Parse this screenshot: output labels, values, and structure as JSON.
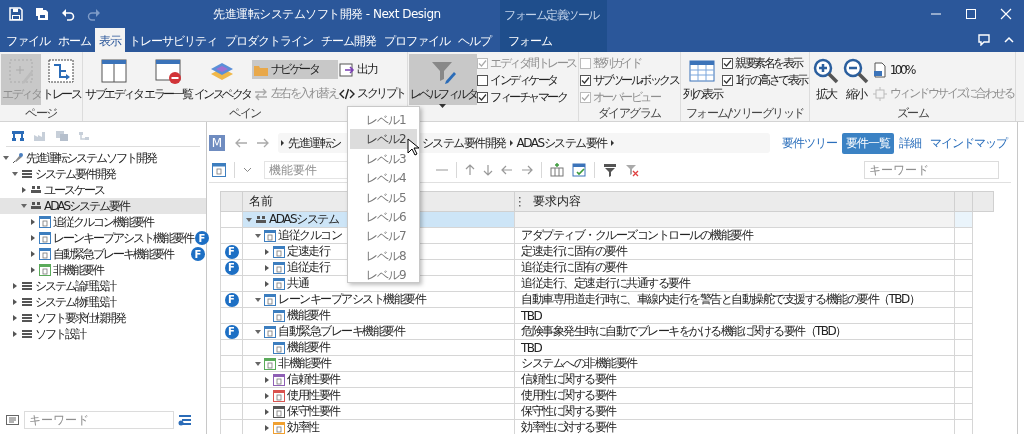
{
  "window": {
    "title": "先進運転システムソフト開発 - Next Design",
    "context_label": "フォーム定義ツール"
  },
  "tabs": [
    {
      "label": "ファイル",
      "kind": "main",
      "selected": false
    },
    {
      "label": "ホーム",
      "kind": "main",
      "selected": false
    },
    {
      "label": "表示",
      "kind": "main",
      "selected": true
    },
    {
      "label": "トレーサビリティ",
      "kind": "main",
      "selected": false
    },
    {
      "label": "プロダクトライン",
      "kind": "main",
      "selected": false
    },
    {
      "label": "チーム開発",
      "kind": "main",
      "selected": false
    },
    {
      "label": "プロファイル",
      "kind": "main",
      "selected": false
    },
    {
      "label": "ヘルプ",
      "kind": "main",
      "selected": false
    },
    {
      "label": "フォーム",
      "kind": "context",
      "selected": false
    }
  ],
  "ribbon": [
    {
      "label": "ページ",
      "columns": [
        [
          {
            "kind": "large",
            "label": "エディタ",
            "pressed": true,
            "disabled": true
          }
        ],
        [
          {
            "kind": "large",
            "label": "トレース",
            "pressed": false,
            "disabled": false
          }
        ]
      ]
    },
    {
      "label": "ペイン",
      "columns": [
        [
          {
            "kind": "large",
            "label": "サブエディタ",
            "pressed": false,
            "disabled": false
          }
        ],
        [
          {
            "kind": "large",
            "label": "エラー一覧",
            "pressed": false,
            "disabled": false
          }
        ],
        [
          {
            "kind": "large",
            "label": "インスペクタ",
            "pressed": false,
            "disabled": false
          }
        ],
        [
          {
            "kind": "small",
            "label": "ナビゲータ",
            "pressed": true,
            "disabled": false
          },
          {
            "kind": "small",
            "label": "左右を入れ替え",
            "pressed": false,
            "disabled": true
          }
        ],
        [
          {
            "kind": "small",
            "label": "出力",
            "pressed": false,
            "disabled": false
          },
          {
            "kind": "small",
            "label": "スクリプト",
            "pressed": false,
            "disabled": false
          }
        ]
      ]
    },
    {
      "columns": [
        [
          {
            "kind": "large",
            "label": "レベルフィルタ",
            "pressed": true,
            "disabled": false,
            "menu": true
          }
        ],
        [
          {
            "kind": "check",
            "label": "エディタ間トレース",
            "checked": true,
            "disabled": true
          },
          {
            "kind": "check",
            "label": "インディケータ",
            "checked": false,
            "disabled": false
          },
          {
            "kind": "check",
            "label": "フィーチャマーク",
            "checked": true,
            "disabled": false
          }
        ]
      ]
    },
    {
      "label": "ダイアグラム",
      "columns": [
        [
          {
            "kind": "check",
            "label": "整列ガイド",
            "checked": false,
            "disabled": true
          },
          {
            "kind": "check",
            "label": "サブツールボックス",
            "checked": true,
            "disabled": false
          },
          {
            "kind": "check",
            "label": "オーバービュー",
            "checked": true,
            "disabled": true
          }
        ]
      ]
    },
    {
      "label": "フォーム/ツリーグリッド",
      "columns": [
        [
          {
            "kind": "large",
            "label": "列の表示",
            "pressed": false,
            "disabled": false
          }
        ],
        [
          {
            "kind": "check",
            "label": "親要素名を表示",
            "checked": true,
            "disabled": false
          },
          {
            "kind": "check",
            "label": "1行の高さで表示",
            "checked": true,
            "disabled": false
          }
        ]
      ]
    },
    {
      "label": "ズーム",
      "columns": [
        [
          {
            "kind": "large",
            "label": "拡大",
            "pressed": false,
            "disabled": false
          }
        ],
        [
          {
            "kind": "large",
            "label": "縮小",
            "pressed": false,
            "disabled": false
          }
        ],
        [
          {
            "kind": "small",
            "label": "100%",
            "pressed": false,
            "disabled": false
          },
          {
            "kind": "small",
            "label": "ウィンドウサイズに合わせる",
            "pressed": false,
            "disabled": true
          }
        ]
      ]
    }
  ],
  "left_panel": {
    "tree": [
      {
        "label": "先進運転システムソフト開発",
        "kind": "project",
        "expanded": true,
        "selected": false,
        "children": [
          {
            "label": "システム要件開発",
            "kind": "list",
            "expanded": true,
            "selected": false,
            "children": [
              {
                "label": "ユースケース",
                "kind": "group",
                "expanded": false,
                "selected": false
              },
              {
                "label": "ADASシステム要件",
                "kind": "group",
                "expanded": true,
                "selected": true,
                "children": [
                  {
                    "label": "追従クルコン機能要件",
                    "kind": "requirement",
                    "color": "#3d7ebf",
                    "expanded": false,
                    "selected": false
                  },
                  {
                    "label": "レーンキープアシスト機能要件",
                    "kind": "requirement",
                    "color": "#3d7ebf",
                    "expanded": false,
                    "selected": false,
                    "badge": "F"
                  },
                  {
                    "label": "自動緊急ブレーキ機能要件",
                    "kind": "requirement",
                    "color": "#3d7ebf",
                    "expanded": false,
                    "selected": false,
                    "badge": "F"
                  },
                  {
                    "label": "非機能要件",
                    "kind": "requirement",
                    "color": "#5aaa5a",
                    "expanded": false,
                    "selected": false
                  }
                ]
              }
            ]
          },
          {
            "label": "システム論理設計",
            "kind": "list",
            "expanded": false,
            "selected": false
          },
          {
            "label": "システム物理設計",
            "kind": "list",
            "expanded": false,
            "selected": false
          },
          {
            "label": "ソフト要求仕様開発",
            "kind": "list",
            "expanded": false,
            "selected": false
          },
          {
            "label": "ソフト設計",
            "kind": "list",
            "expanded": false,
            "selected": false
          }
        ]
      }
    ],
    "search": {
      "placeholder": "キーワード"
    }
  },
  "editor": {
    "badge": "M",
    "breadcrumb": [
      "先進運転シ",
      "システム要件開発",
      "ADASシステム要件"
    ],
    "views": [
      {
        "label": "要件ツリー",
        "selected": false
      },
      {
        "label": "要件一覧",
        "selected": true
      },
      {
        "label": "詳細",
        "selected": false
      },
      {
        "label": "マインドマップ",
        "selected": false
      }
    ],
    "type_field": {
      "placeholder": "機能要件"
    },
    "keyword_field": {
      "placeholder": "キーワード"
    },
    "table": {
      "columns": [
        "名前",
        "要求内容"
      ],
      "rows": [
        {
          "name": "ADASシステム",
          "kind": "group",
          "expanded": true,
          "selected": true,
          "children": [
            {
              "name": "追従クルコン",
              "kind": "requirement",
              "color": "#3d7ebf",
              "expanded": true,
              "selected": false,
              "content": "アダプティブ・クルーズコントロールの機能要件",
              "children": [
                {
                  "name": "定速走行",
                  "kind": "requirement",
                  "color": "#3d7ebf",
                  "expanded": false,
                  "selected": false,
                  "badge": "F",
                  "content": "定速走行に固有の要件"
                },
                {
                  "name": "追従走行",
                  "kind": "requirement",
                  "color": "#3d7ebf",
                  "expanded": false,
                  "selected": false,
                  "badge": "F",
                  "content": "追従走行に固有の要件"
                },
                {
                  "name": "共通",
                  "kind": "requirement",
                  "color": "#3d7ebf",
                  "expanded": false,
                  "selected": false,
                  "content": "追従走行、定速走行に共通する要件"
                }
              ]
            },
            {
              "name": "レーンキープアシスト機能要件",
              "kind": "requirement",
              "color": "#3d7ebf",
              "expanded": true,
              "selected": false,
              "badge": "F",
              "content": "自動車専用道走行時に、車線内走行を警告と自動操舵で支援する機能の要件（TBD）",
              "children": [
                {
                  "name": "機能要件",
                  "kind": "requirement",
                  "color": "#3d7ebf",
                  "selected": false,
                  "content": "TBD"
                }
              ]
            },
            {
              "name": "自動緊急ブレーキ機能要件",
              "kind": "requirement",
              "color": "#3d7ebf",
              "expanded": true,
              "selected": false,
              "badge": "F",
              "content": "危険事象発生時に自動でブレーキをかける機能に関する要件（TBD）",
              "children": [
                {
                  "name": "機能要件",
                  "kind": "requirement",
                  "color": "#3d7ebf",
                  "selected": false,
                  "content": "TBD"
                }
              ]
            },
            {
              "name": "非機能要件",
              "kind": "requirement",
              "color": "#5aaa5a",
              "expanded": true,
              "selected": false,
              "content": "システムへの非機能要件",
              "children": [
                {
                  "name": "信頼性要件",
                  "kind": "requirement",
                  "color": "#8e5fb5",
                  "expanded": false,
                  "selected": false,
                  "content": "信頼性に関する要件"
                },
                {
                  "name": "使用性要件",
                  "kind": "requirement",
                  "color": "#d9534f",
                  "expanded": false,
                  "selected": false,
                  "content": "使用性に関する要件"
                },
                {
                  "name": "保守性要件",
                  "kind": "requirement",
                  "color": "#555555",
                  "expanded": false,
                  "selected": false,
                  "content": "保守性に関する要件"
                },
                {
                  "name": "効率性",
                  "kind": "requirement",
                  "color": "#f0a030",
                  "expanded": false,
                  "selected": false,
                  "content": "効率性に対する要件"
                }
              ]
            }
          ]
        }
      ]
    }
  },
  "level_menu": {
    "items": [
      {
        "label": "レベル1",
        "selected": false
      },
      {
        "label": "レベル2",
        "selected": true
      },
      {
        "label": "レベル3",
        "selected": false
      },
      {
        "label": "レベル4",
        "selected": false
      },
      {
        "label": "レベル5",
        "selected": false
      },
      {
        "label": "レベル6",
        "selected": false
      },
      {
        "label": "レベル7",
        "selected": false
      },
      {
        "label": "レベル8",
        "selected": false
      },
      {
        "label": "レベル9",
        "selected": false
      }
    ]
  }
}
